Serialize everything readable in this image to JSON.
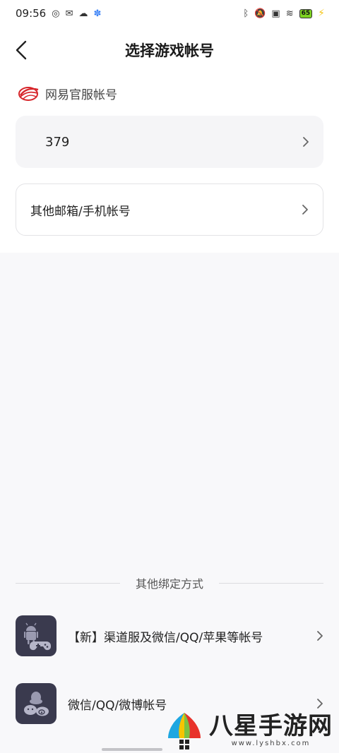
{
  "status_bar": {
    "time": "09:56",
    "battery_level": "65"
  },
  "header": {
    "title": "选择游戏帐号"
  },
  "netease_section": {
    "label": "网易官服帐号"
  },
  "accounts": [
    {
      "label": "379"
    },
    {
      "label": "其他邮箱/手机帐号"
    }
  ],
  "other_bind": {
    "divider_text": "其他绑定方式",
    "items": [
      {
        "label": "【新】渠道服及微信/QQ/苹果等帐号"
      },
      {
        "label": "微信/QQ/微博帐号"
      }
    ]
  },
  "watermark": {
    "title": "八星手游网",
    "url": "www.lyshbx.com"
  },
  "colors": {
    "background": "#f8f8fa",
    "card": "#ffffff",
    "icon_tile": "#3a3a4e",
    "netease_red": "#d7262b",
    "battery_green": "#7ed321"
  }
}
